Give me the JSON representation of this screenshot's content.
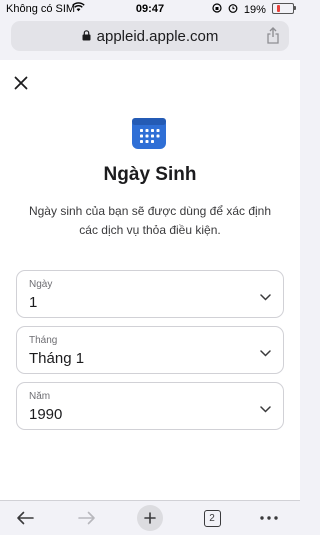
{
  "status_bar": {
    "carrier": "Không có SIM",
    "time": "09:47",
    "battery_percent": "19%",
    "battery_level": 0.19
  },
  "url_bar": {
    "url": "appleid.apple.com"
  },
  "dialog": {
    "title": "Ngày Sinh",
    "description": "Ngày sinh của bạn sẽ được dùng để xác định các dịch vụ thỏa điều kiện.",
    "fields": [
      {
        "label": "Ngày",
        "value": "1"
      },
      {
        "label": "Tháng",
        "value": "Tháng 1"
      },
      {
        "label": "Năm",
        "value": "1990"
      }
    ]
  },
  "toolbar": {
    "tab_count": "2"
  },
  "icons": {
    "close": "close-icon",
    "calendar": "calendar-icon",
    "share": "share-icon",
    "back": "back-arrow-icon",
    "forward": "forward-arrow-icon",
    "new_tab": "plus-icon",
    "more": "more-icon"
  },
  "colors": {
    "accent": "#2f6fd6",
    "battery_low": "#e8413a"
  }
}
